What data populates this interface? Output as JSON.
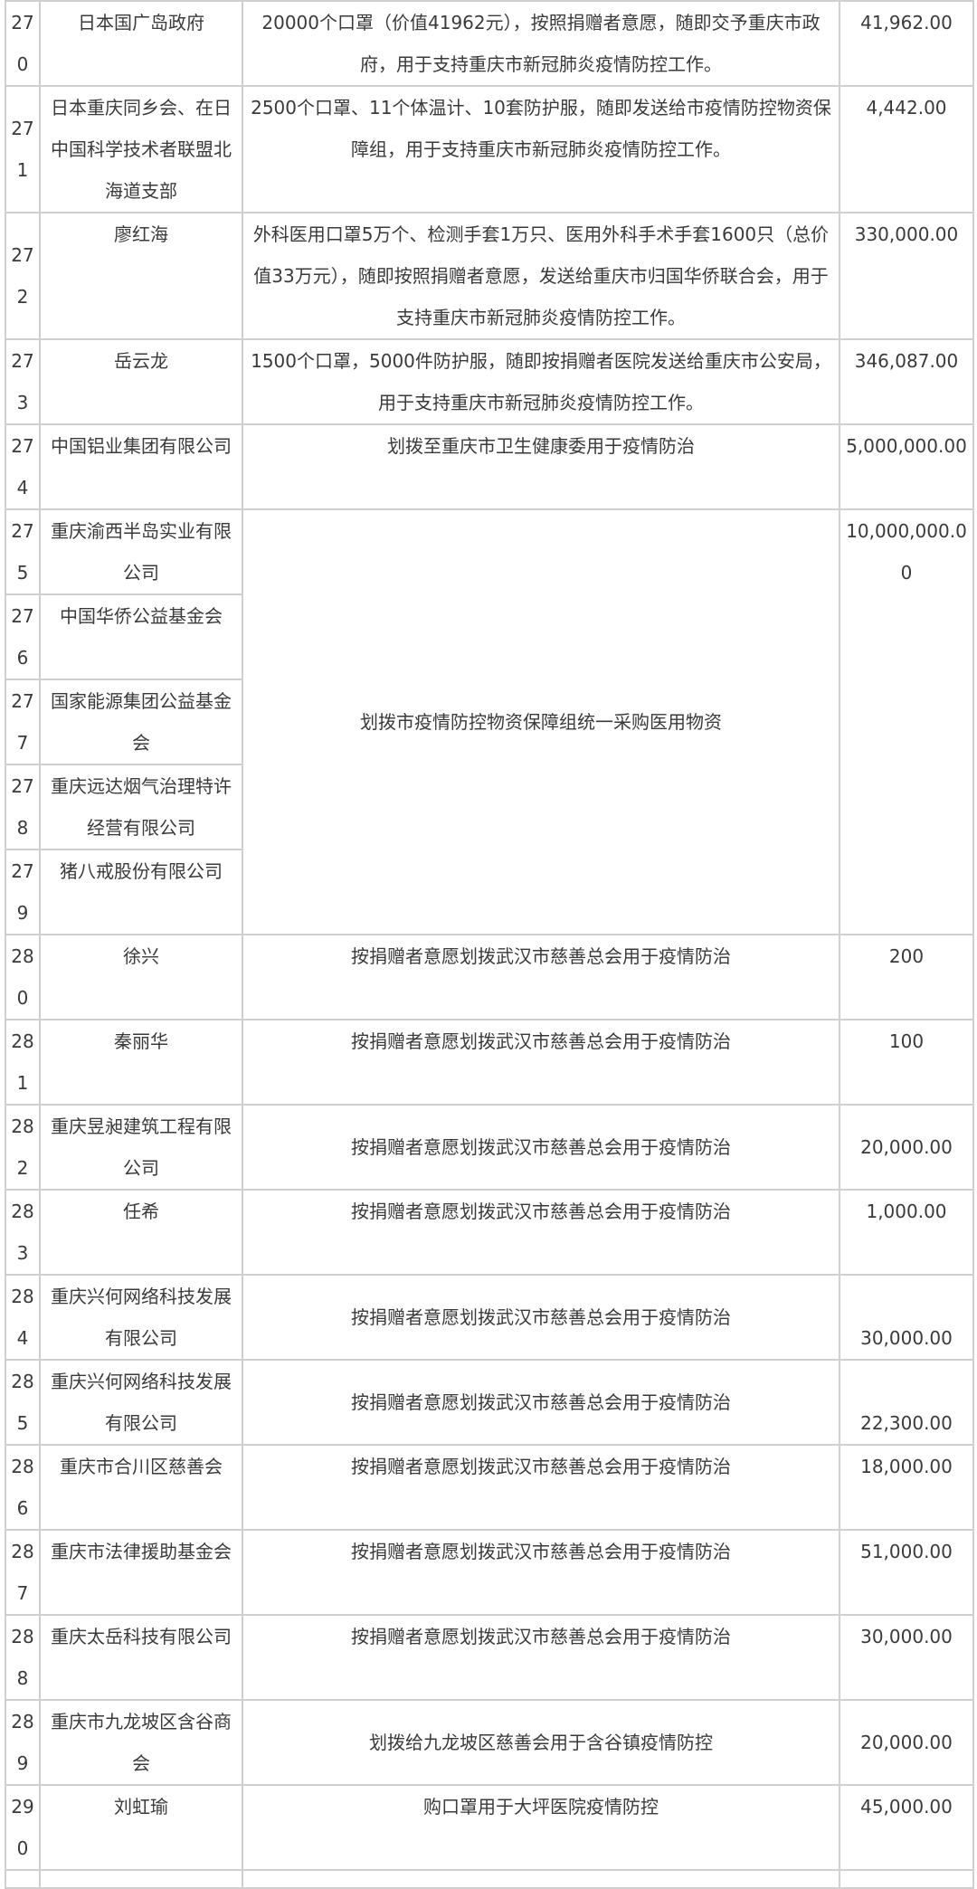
{
  "rows": [
    {
      "no": "270",
      "donor": "日本国广岛政府",
      "use": "20000个口罩（价值41962元），按照捐赠者意愿，随即交予重庆市政府，用于支持重庆市新冠肺炎疫情防控工作。",
      "amount": "41,962.00"
    },
    {
      "no": "271",
      "donor": "日本重庆同乡会、在日中国科学技术者联盟北海道支部",
      "use": "2500个口罩、11个体温计、10套防护服，随即发送给市疫情防控物资保障组，用于支持重庆市新冠肺炎疫情防控工作。",
      "amount": "4,442.00"
    },
    {
      "no": "272",
      "donor": "廖红海",
      "use": "外科医用口罩5万个、检测手套1万只、医用外科手术手套1600只（总价值33万元），随即按照捐赠者意愿，发送给重庆市归国华侨联合会，用于支持重庆市新冠肺炎疫情防控工作。",
      "amount": "330,000.00"
    },
    {
      "no": "273",
      "donor": "岳云龙",
      "use": "1500个口罩，5000件防护服，随即按捐赠者医院发送给重庆市公安局，用于支持重庆市新冠肺炎疫情防控工作。",
      "amount": "346,087.00"
    },
    {
      "no": "274",
      "donor": "中国铝业集团有限公司",
      "use": "划拨至重庆市卫生健康委用于疫情防治",
      "amount": "5,000,000.00"
    },
    {
      "no": "275",
      "donor": "重庆渝西半岛实业有限公司",
      "use": "划拨市疫情防控物资保障组统一采购医用物资",
      "amount": "10,000,000.00"
    },
    {
      "no": "276",
      "donor": "中国华侨公益基金会"
    },
    {
      "no": "277",
      "donor": "国家能源集团公益基金会"
    },
    {
      "no": "278",
      "donor": "重庆远达烟气治理特许经营有限公司"
    },
    {
      "no": "279",
      "donor": "猪八戒股份有限公司"
    },
    {
      "no": "280",
      "donor": "徐兴",
      "use": "按捐赠者意愿划拨武汉市慈善总会用于疫情防治",
      "amount": "200"
    },
    {
      "no": "281",
      "donor": "秦丽华",
      "use": "按捐赠者意愿划拨武汉市慈善总会用于疫情防治",
      "amount": "100"
    },
    {
      "no": "282",
      "donor": "重庆昱昶建筑工程有限公司",
      "use": "按捐赠者意愿划拨武汉市慈善总会用于疫情防治",
      "amount": "20,000.00"
    },
    {
      "no": "283",
      "donor": "任希",
      "use": "按捐赠者意愿划拨武汉市慈善总会用于疫情防治",
      "amount": "1,000.00"
    },
    {
      "no": "284",
      "donor": "重庆兴何网络科技发展有限公司",
      "use": "按捐赠者意愿划拨武汉市慈善总会用于疫情防治",
      "amount": "30,000.00"
    },
    {
      "no": "285",
      "donor": "重庆兴何网络科技发展有限公司",
      "use": "按捐赠者意愿划拨武汉市慈善总会用于疫情防治",
      "amount": "22,300.00"
    },
    {
      "no": "286",
      "donor": "重庆市合川区慈善会",
      "use": "按捐赠者意愿划拨武汉市慈善总会用于疫情防治",
      "amount": "18,000.00"
    },
    {
      "no": "287",
      "donor": "重庆市法律援助基金会",
      "use": "按捐赠者意愿划拨武汉市慈善总会用于疫情防治",
      "amount": "51,000.00"
    },
    {
      "no": "288",
      "donor": "重庆太岳科技有限公司",
      "use": "按捐赠者意愿划拨武汉市慈善总会用于疫情防治",
      "amount": "30,000.00"
    },
    {
      "no": "289",
      "donor": "重庆市九龙坡区含谷商会",
      "use": "划拨给九龙坡区慈善会用于含谷镇疫情防控",
      "amount": "20,000.00"
    },
    {
      "no": "290",
      "donor": "刘虹瑜",
      "use": "购口罩用于大坪医院疫情防控",
      "amount": "45,000.00"
    }
  ]
}
